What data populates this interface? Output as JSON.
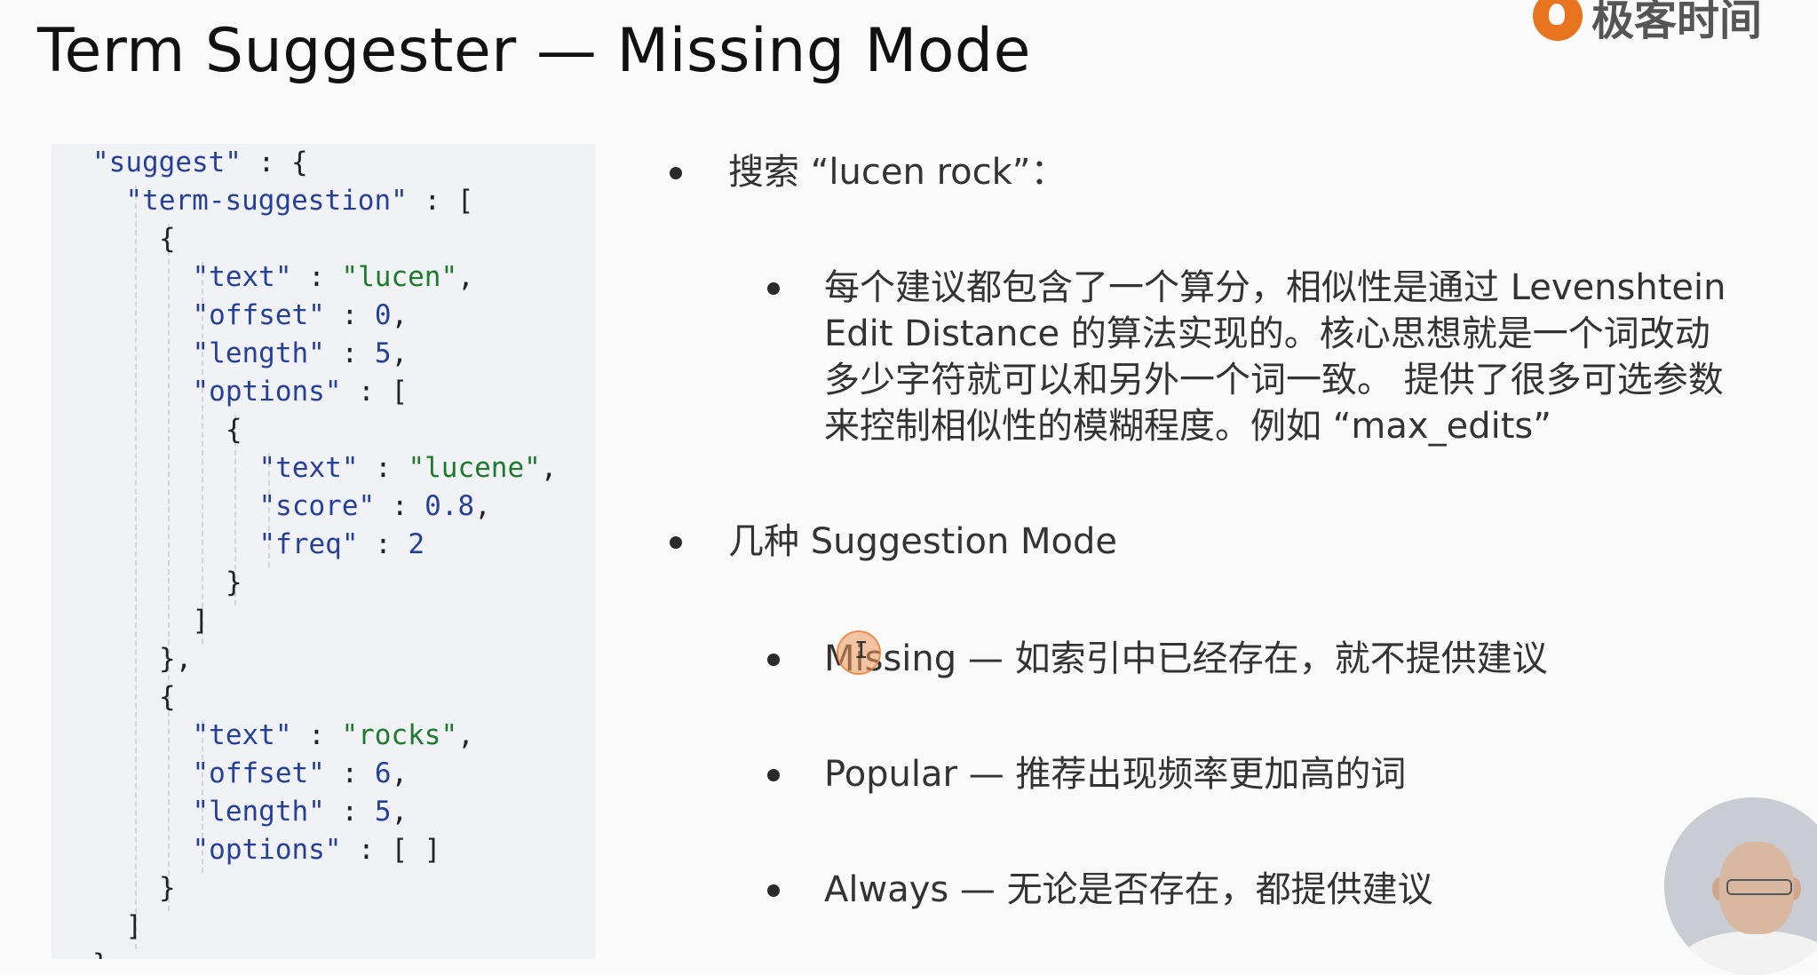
{
  "slide": {
    "title": "Term Suggester — Missing Mode"
  },
  "logo": {
    "text": "极客时间",
    "icon": "geektime-logo-icon"
  },
  "code": {
    "lines": [
      {
        "indent": 1,
        "tokens": [
          [
            "k",
            "\"suggest\""
          ],
          [
            "p",
            " : {"
          ]
        ]
      },
      {
        "indent": 2,
        "tokens": [
          [
            "k",
            "\"term-suggestion\""
          ],
          [
            "p",
            " : ["
          ]
        ]
      },
      {
        "indent": 3,
        "tokens": [
          [
            "p",
            "{"
          ]
        ]
      },
      {
        "indent": 4,
        "tokens": [
          [
            "k",
            "\"text\""
          ],
          [
            "p",
            " : "
          ],
          [
            "s",
            "\"lucen\""
          ],
          [
            "p",
            ","
          ]
        ]
      },
      {
        "indent": 4,
        "tokens": [
          [
            "k",
            "\"offset\""
          ],
          [
            "p",
            " : "
          ],
          [
            "n",
            "0"
          ],
          [
            "p",
            ","
          ]
        ]
      },
      {
        "indent": 4,
        "tokens": [
          [
            "k",
            "\"length\""
          ],
          [
            "p",
            " : "
          ],
          [
            "n",
            "5"
          ],
          [
            "p",
            ","
          ]
        ]
      },
      {
        "indent": 4,
        "tokens": [
          [
            "k",
            "\"options\""
          ],
          [
            "p",
            " : ["
          ]
        ]
      },
      {
        "indent": 5,
        "tokens": [
          [
            "p",
            "{"
          ]
        ]
      },
      {
        "indent": 6,
        "tokens": [
          [
            "k",
            "\"text\""
          ],
          [
            "p",
            " : "
          ],
          [
            "s",
            "\"lucene\""
          ],
          [
            "p",
            ","
          ]
        ]
      },
      {
        "indent": 6,
        "tokens": [
          [
            "k",
            "\"score\""
          ],
          [
            "p",
            " : "
          ],
          [
            "n",
            "0.8"
          ],
          [
            "p",
            ","
          ]
        ]
      },
      {
        "indent": 6,
        "tokens": [
          [
            "k",
            "\"freq\""
          ],
          [
            "p",
            " : "
          ],
          [
            "n",
            "2"
          ]
        ]
      },
      {
        "indent": 5,
        "tokens": [
          [
            "p",
            "}"
          ]
        ]
      },
      {
        "indent": 4,
        "tokens": [
          [
            "p",
            "]"
          ]
        ]
      },
      {
        "indent": 3,
        "tokens": [
          [
            "p",
            "},"
          ]
        ]
      },
      {
        "indent": 3,
        "tokens": [
          [
            "p",
            "{"
          ]
        ]
      },
      {
        "indent": 4,
        "tokens": [
          [
            "k",
            "\"text\""
          ],
          [
            "p",
            " : "
          ],
          [
            "s",
            "\"rocks\""
          ],
          [
            "p",
            ","
          ]
        ]
      },
      {
        "indent": 4,
        "tokens": [
          [
            "k",
            "\"offset\""
          ],
          [
            "p",
            " : "
          ],
          [
            "n",
            "6"
          ],
          [
            "p",
            ","
          ]
        ]
      },
      {
        "indent": 4,
        "tokens": [
          [
            "k",
            "\"length\""
          ],
          [
            "p",
            " : "
          ],
          [
            "n",
            "5"
          ],
          [
            "p",
            ","
          ]
        ]
      },
      {
        "indent": 4,
        "tokens": [
          [
            "k",
            "\"options\""
          ],
          [
            "p",
            " : [ ]"
          ]
        ]
      },
      {
        "indent": 3,
        "tokens": [
          [
            "p",
            "}"
          ]
        ]
      },
      {
        "indent": 2,
        "tokens": [
          [
            "p",
            "]"
          ]
        ]
      },
      {
        "indent": 1,
        "tokens": [
          [
            "p",
            "}"
          ]
        ]
      }
    ]
  },
  "bullets": {
    "search": "搜索 “lucen rock”：",
    "score_para": [
      "每个建议都包含了一个算分，相似性是通过 Levenshtein",
      "Edit Distance 的算法实现的。核心思想就是一个词改动",
      "多少字符就可以和另外一个词一致。 提供了很多可选参数",
      "来控制相似性的模糊程度。例如 “max_edits”"
    ],
    "modes_heading": "几种 Suggestion Mode",
    "missing": "Missing — 如索引中已经存在，就不提供建议",
    "popular": "Popular — 推荐出现频率更加高的词",
    "always": "Always — 无论是否存在，都提供建议"
  },
  "colors": {
    "key": "#26409a",
    "string": "#1d7a2e",
    "accent": "#e8741f"
  }
}
